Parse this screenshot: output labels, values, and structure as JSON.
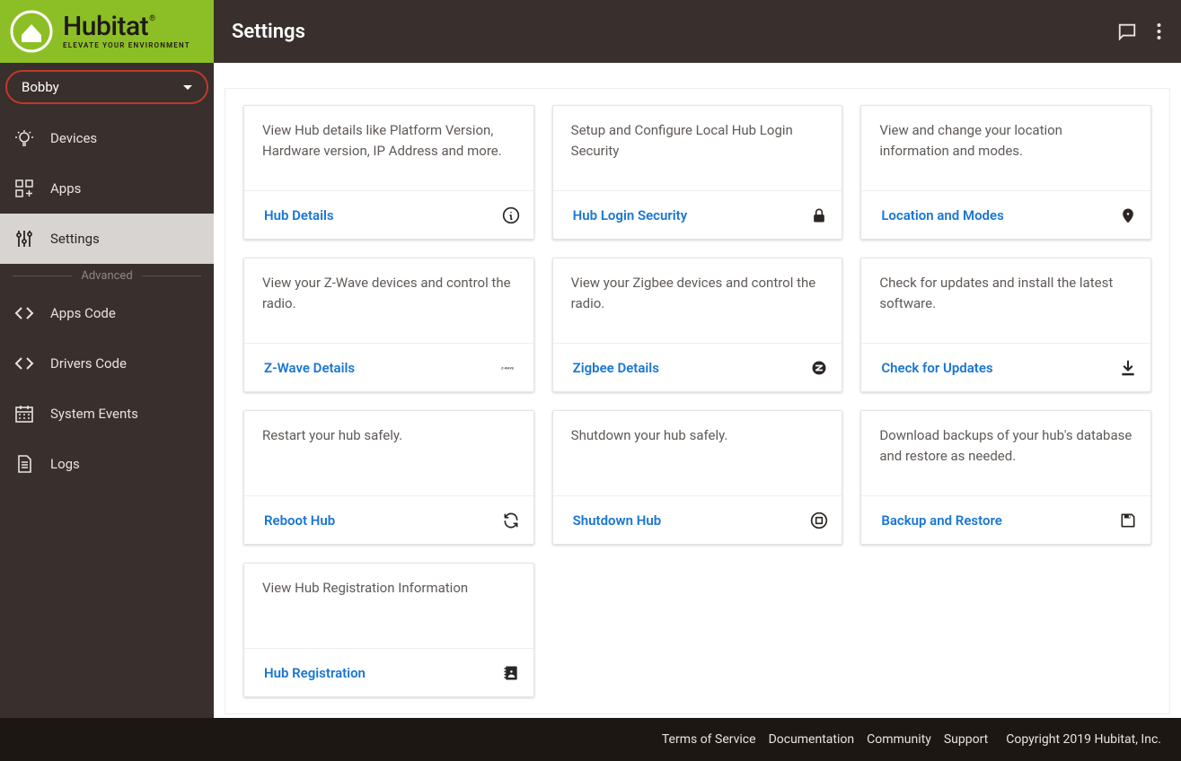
{
  "brand": {
    "name": "Hubitat",
    "tagline": "ELEVATE YOUR ENVIRONMENT"
  },
  "header": {
    "title": "Settings"
  },
  "hub_selector": {
    "selected": "Bobby"
  },
  "sidebar": {
    "items": [
      {
        "label": "Devices"
      },
      {
        "label": "Apps"
      },
      {
        "label": "Settings"
      }
    ],
    "advanced_label": "Advanced",
    "advanced": [
      {
        "label": "Apps Code"
      },
      {
        "label": "Drivers Code"
      },
      {
        "label": "System Events"
      },
      {
        "label": "Logs"
      }
    ]
  },
  "cards": [
    {
      "desc": "View Hub details like Platform Version, Hardware version, IP Address and more.",
      "link": "Hub Details",
      "icon": "info"
    },
    {
      "desc": "Setup and Configure Local Hub Login Security",
      "link": "Hub Login Security",
      "icon": "lock"
    },
    {
      "desc": "View and change your location information and modes.",
      "link": "Location and Modes",
      "icon": "pin"
    },
    {
      "desc": "View your Z-Wave devices and control the radio.",
      "link": "Z-Wave Details",
      "icon": "zwave"
    },
    {
      "desc": "View your Zigbee devices and control the radio.",
      "link": "Zigbee Details",
      "icon": "zigbee"
    },
    {
      "desc": "Check for updates and install the latest software.",
      "link": "Check for Updates",
      "icon": "download"
    },
    {
      "desc": "Restart your hub safely.",
      "link": "Reboot Hub",
      "icon": "refresh"
    },
    {
      "desc": "Shutdown your hub safely.",
      "link": "Shutdown Hub",
      "icon": "power"
    },
    {
      "desc": "Download backups of your hub's database and restore as needed.",
      "link": "Backup and Restore",
      "icon": "save"
    },
    {
      "desc": "View Hub Registration Information",
      "link": "Hub Registration",
      "icon": "contacts"
    }
  ],
  "footer": {
    "links": [
      "Terms of Service",
      "Documentation",
      "Community",
      "Support"
    ],
    "copyright": "Copyright 2019 Hubitat, Inc."
  }
}
